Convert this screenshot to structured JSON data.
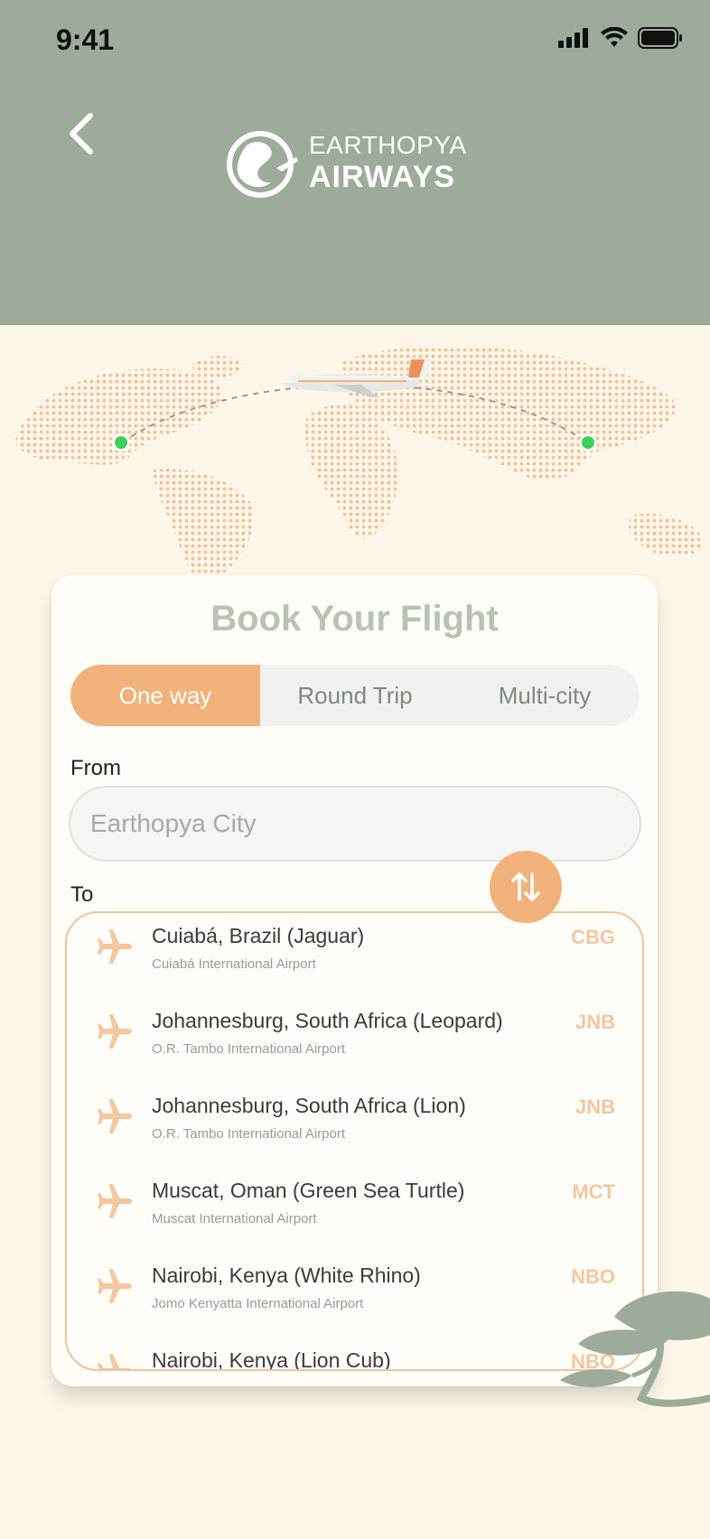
{
  "status_bar": {
    "time": "9:41"
  },
  "brand": {
    "line1": "EARTHOPYA",
    "line2": "AIRWAYS"
  },
  "card": {
    "title": "Book Your Flight",
    "tabs": [
      {
        "label": "One way",
        "active": true
      },
      {
        "label": "Round Trip",
        "active": false
      },
      {
        "label": "Multi-city",
        "active": false
      }
    ],
    "from_label": "From",
    "from_placeholder": "Earthopya City",
    "to_label": "To"
  },
  "destinations": [
    {
      "city": "Cuiabá, Brazil (Jaguar)",
      "airport": "Cuiabá International Airport",
      "code": "CBG"
    },
    {
      "city": "Johannesburg, South Africa (Leopard)",
      "airport": "O.R. Tambo International Airport",
      "code": "JNB"
    },
    {
      "city": "Johannesburg, South Africa (Lion)",
      "airport": "O.R. Tambo International Airport",
      "code": "JNB"
    },
    {
      "city": "Muscat, Oman (Green Sea Turtle)",
      "airport": "Muscat International Airport",
      "code": "MCT"
    },
    {
      "city": "Nairobi, Kenya (White Rhino)",
      "airport": "Jomo Kenyatta International Airport",
      "code": "NBO"
    },
    {
      "city": "Nairobi, Kenya (Lion Cub)",
      "airport": "",
      "code": "NBO"
    }
  ],
  "colors": {
    "header": "#9dab9b",
    "background": "#fdf7ea",
    "accent": "#f2b27c",
    "code": "#f4c79f",
    "route_dot": "#3ed15a"
  },
  "icons": [
    "cellular-icon",
    "wifi-icon",
    "battery-icon",
    "back-chevron-icon",
    "globe-logo-icon",
    "swap-icon",
    "plane-icon",
    "tree-icon"
  ]
}
